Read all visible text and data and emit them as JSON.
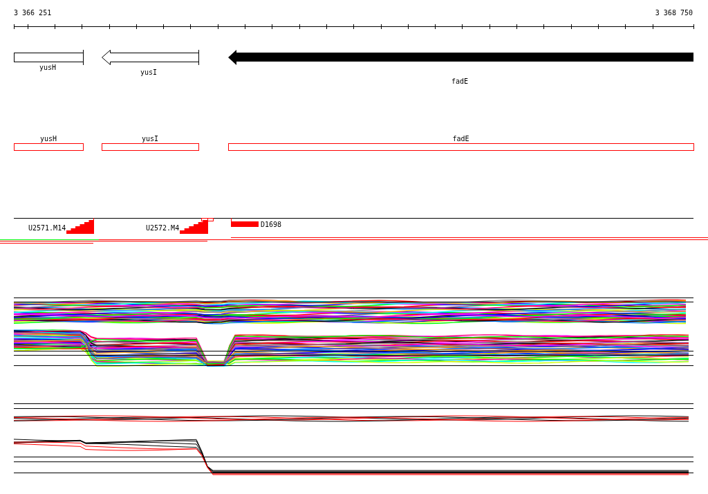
{
  "ruler": {
    "start": "3 366 251",
    "end": "3 368 750"
  },
  "genes": [
    {
      "name": "yusH",
      "kind": "box"
    },
    {
      "name": "yusI",
      "kind": "arrow-open"
    },
    {
      "name": "fadE",
      "kind": "arrow-filled"
    }
  ],
  "annotations": [
    {
      "name": "yusH"
    },
    {
      "name": "yusI"
    },
    {
      "name": "fadE"
    }
  ],
  "probes": [
    {
      "label": "U2571.M14",
      "kind": "ramp"
    },
    {
      "label": "U2572.M4",
      "kind": "ramp"
    },
    {
      "label": "D1698",
      "kind": "bar"
    }
  ]
}
